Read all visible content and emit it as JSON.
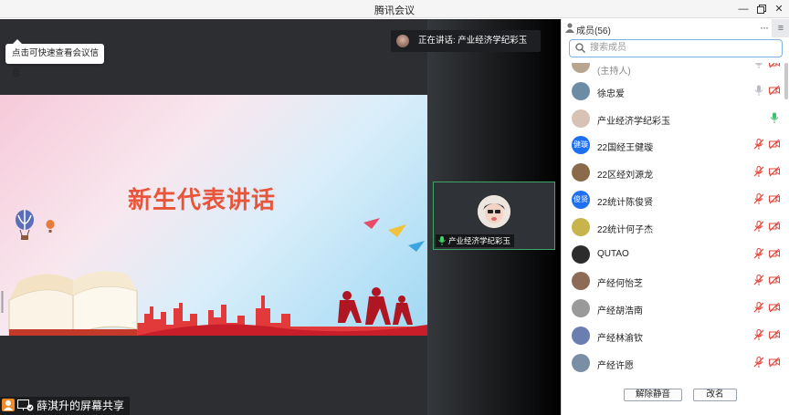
{
  "window": {
    "title": "腾讯会议",
    "controls": [
      "minimize-icon",
      "restore-icon",
      "close-icon"
    ]
  },
  "stage": {
    "info_tooltip": "点击可快速查看会议信息",
    "speaking": "正在讲话: 产业经济学纪彩玉",
    "slide_title": "新生代表讲话",
    "video_tile_name": "产业经济学纪彩玉",
    "share_label": "薛淇升的屏幕共享"
  },
  "panel": {
    "title": "成员(56)",
    "more_label": "···",
    "menu_label": "≡",
    "search_placeholder": "搜索成员",
    "members": [
      {
        "name": "(主持人)",
        "avatar": "",
        "avatar_color": "#b7a58f",
        "mic": "gray",
        "cam": "off",
        "host": true
      },
      {
        "name": "徐忠爱",
        "avatar": "",
        "avatar_color": "#6c8ca5",
        "mic": "gray",
        "cam": "off"
      },
      {
        "name": "产业经济学纪彩玉",
        "avatar": "",
        "avatar_color": "#d8c2b6",
        "mic": "green",
        "cam": "none"
      },
      {
        "name": "22国经王健璇",
        "avatar": "健璇",
        "avatar_color": "#1f6ff2",
        "mic": "muted",
        "cam": "off"
      },
      {
        "name": "22区经刘源龙",
        "avatar": "",
        "avatar_color": "#8a6a4a",
        "mic": "muted",
        "cam": "off"
      },
      {
        "name": "22统计陈俊贤",
        "avatar": "俊贤",
        "avatar_color": "#1f6ff2",
        "mic": "muted",
        "cam": "off"
      },
      {
        "name": "22统计何子杰",
        "avatar": "",
        "avatar_color": "#c7b44a",
        "mic": "muted",
        "cam": "off"
      },
      {
        "name": "QUTAO",
        "avatar": "",
        "avatar_color": "#2c2c2c",
        "mic": "muted",
        "cam": "off"
      },
      {
        "name": "产经何怡芝",
        "avatar": "",
        "avatar_color": "#8c6a55",
        "mic": "muted",
        "cam": "off"
      },
      {
        "name": "产经胡浩南",
        "avatar": "",
        "avatar_color": "#9a9a9a",
        "mic": "muted",
        "cam": "off"
      },
      {
        "name": "产经林渝钦",
        "avatar": "",
        "avatar_color": "#6a7fb0",
        "mic": "muted",
        "cam": "off"
      },
      {
        "name": "产经许愿",
        "avatar": "",
        "avatar_color": "#7a8fa5",
        "mic": "muted",
        "cam": "off"
      }
    ],
    "unmute_all": "解除静音",
    "rename": "改名"
  },
  "colors": {
    "accent": "#1f6ff2",
    "muted_red": "#e0443a",
    "speaking_green": "#3fa66a",
    "stage_bg": "#2c2e31"
  }
}
